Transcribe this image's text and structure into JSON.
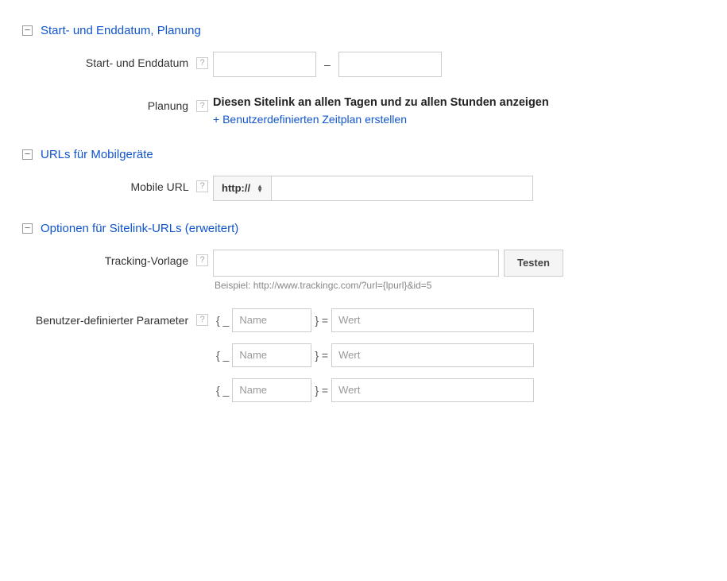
{
  "sections": {
    "dates": {
      "title": "Start- und Enddatum, Planung"
    },
    "mobile": {
      "title": "URLs für Mobilgeräte"
    },
    "advanced": {
      "title": "Optionen für Sitelink-URLs (erweitert)"
    }
  },
  "dates": {
    "label": "Start- und Enddatum",
    "separator": "–",
    "start_value": "",
    "end_value": ""
  },
  "planning": {
    "label": "Planung",
    "bold_text": "Diesen Sitelink an allen Tagen und zu allen Stunden anzeigen",
    "link_text": "+ Benutzerdefinierten Zeitplan erstellen"
  },
  "mobile_url": {
    "label": "Mobile URL",
    "protocol": "http://",
    "value": ""
  },
  "tracking": {
    "label": "Tracking-Vorlage",
    "value": "",
    "test_button": "Testen",
    "example": "Beispiel: http://www.trackingc.com/?url={lpurl}&id=5"
  },
  "custom_params": {
    "label": "Benutzer-definierter Parameter",
    "brace_open": "{ _",
    "brace_close": "} =",
    "name_placeholder": "Name",
    "value_placeholder": "Wert",
    "rows": [
      {
        "name": "",
        "value": ""
      },
      {
        "name": "",
        "value": ""
      },
      {
        "name": "",
        "value": ""
      }
    ]
  },
  "help_icon_char": "?"
}
